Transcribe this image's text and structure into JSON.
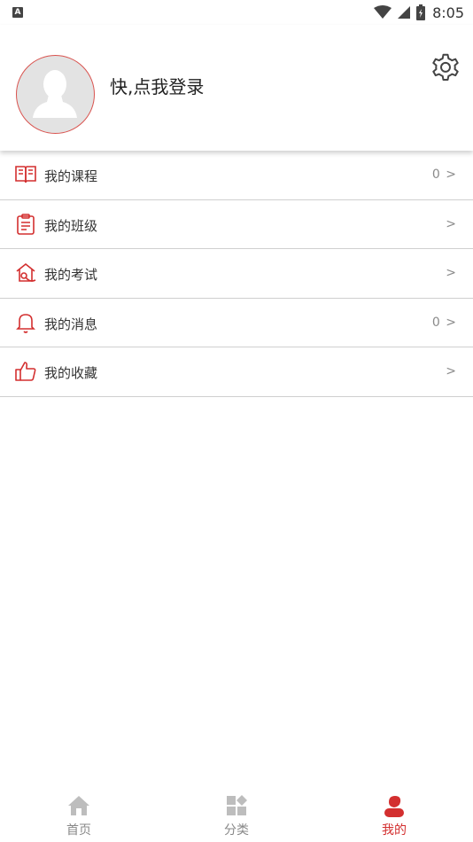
{
  "status_bar": {
    "left_indicator": "A",
    "time": "8:05",
    "icons": [
      "wifi-icon",
      "cell-signal-icon",
      "battery-icon"
    ]
  },
  "profile": {
    "login_prompt": "快,点我登录",
    "avatar_icon": "default-avatar-icon",
    "settings_icon": "gear-icon"
  },
  "menu": {
    "items": [
      {
        "label": "我的课程",
        "right": "0 >",
        "icon": "open-book-icon"
      },
      {
        "label": "我的班级",
        "right": ">",
        "icon": "clipboard-icon"
      },
      {
        "label": "我的考试",
        "right": ">",
        "icon": "exam-house-icon"
      },
      {
        "label": "我的消息",
        "right": "0 >",
        "icon": "bell-icon"
      },
      {
        "label": "我的收藏",
        "right": ">",
        "icon": "thumbs-up-icon"
      }
    ]
  },
  "bottom_nav": {
    "items": [
      {
        "label": "首页",
        "icon": "home-icon",
        "active": false
      },
      {
        "label": "分类",
        "icon": "category-grid-icon",
        "active": false
      },
      {
        "label": "我的",
        "icon": "person-icon",
        "active": true
      }
    ]
  },
  "colors": {
    "accent": "#d32f2f",
    "avatar_border": "#d9534f",
    "divider": "#cfcfcf",
    "inactive_nav": "#888888"
  }
}
